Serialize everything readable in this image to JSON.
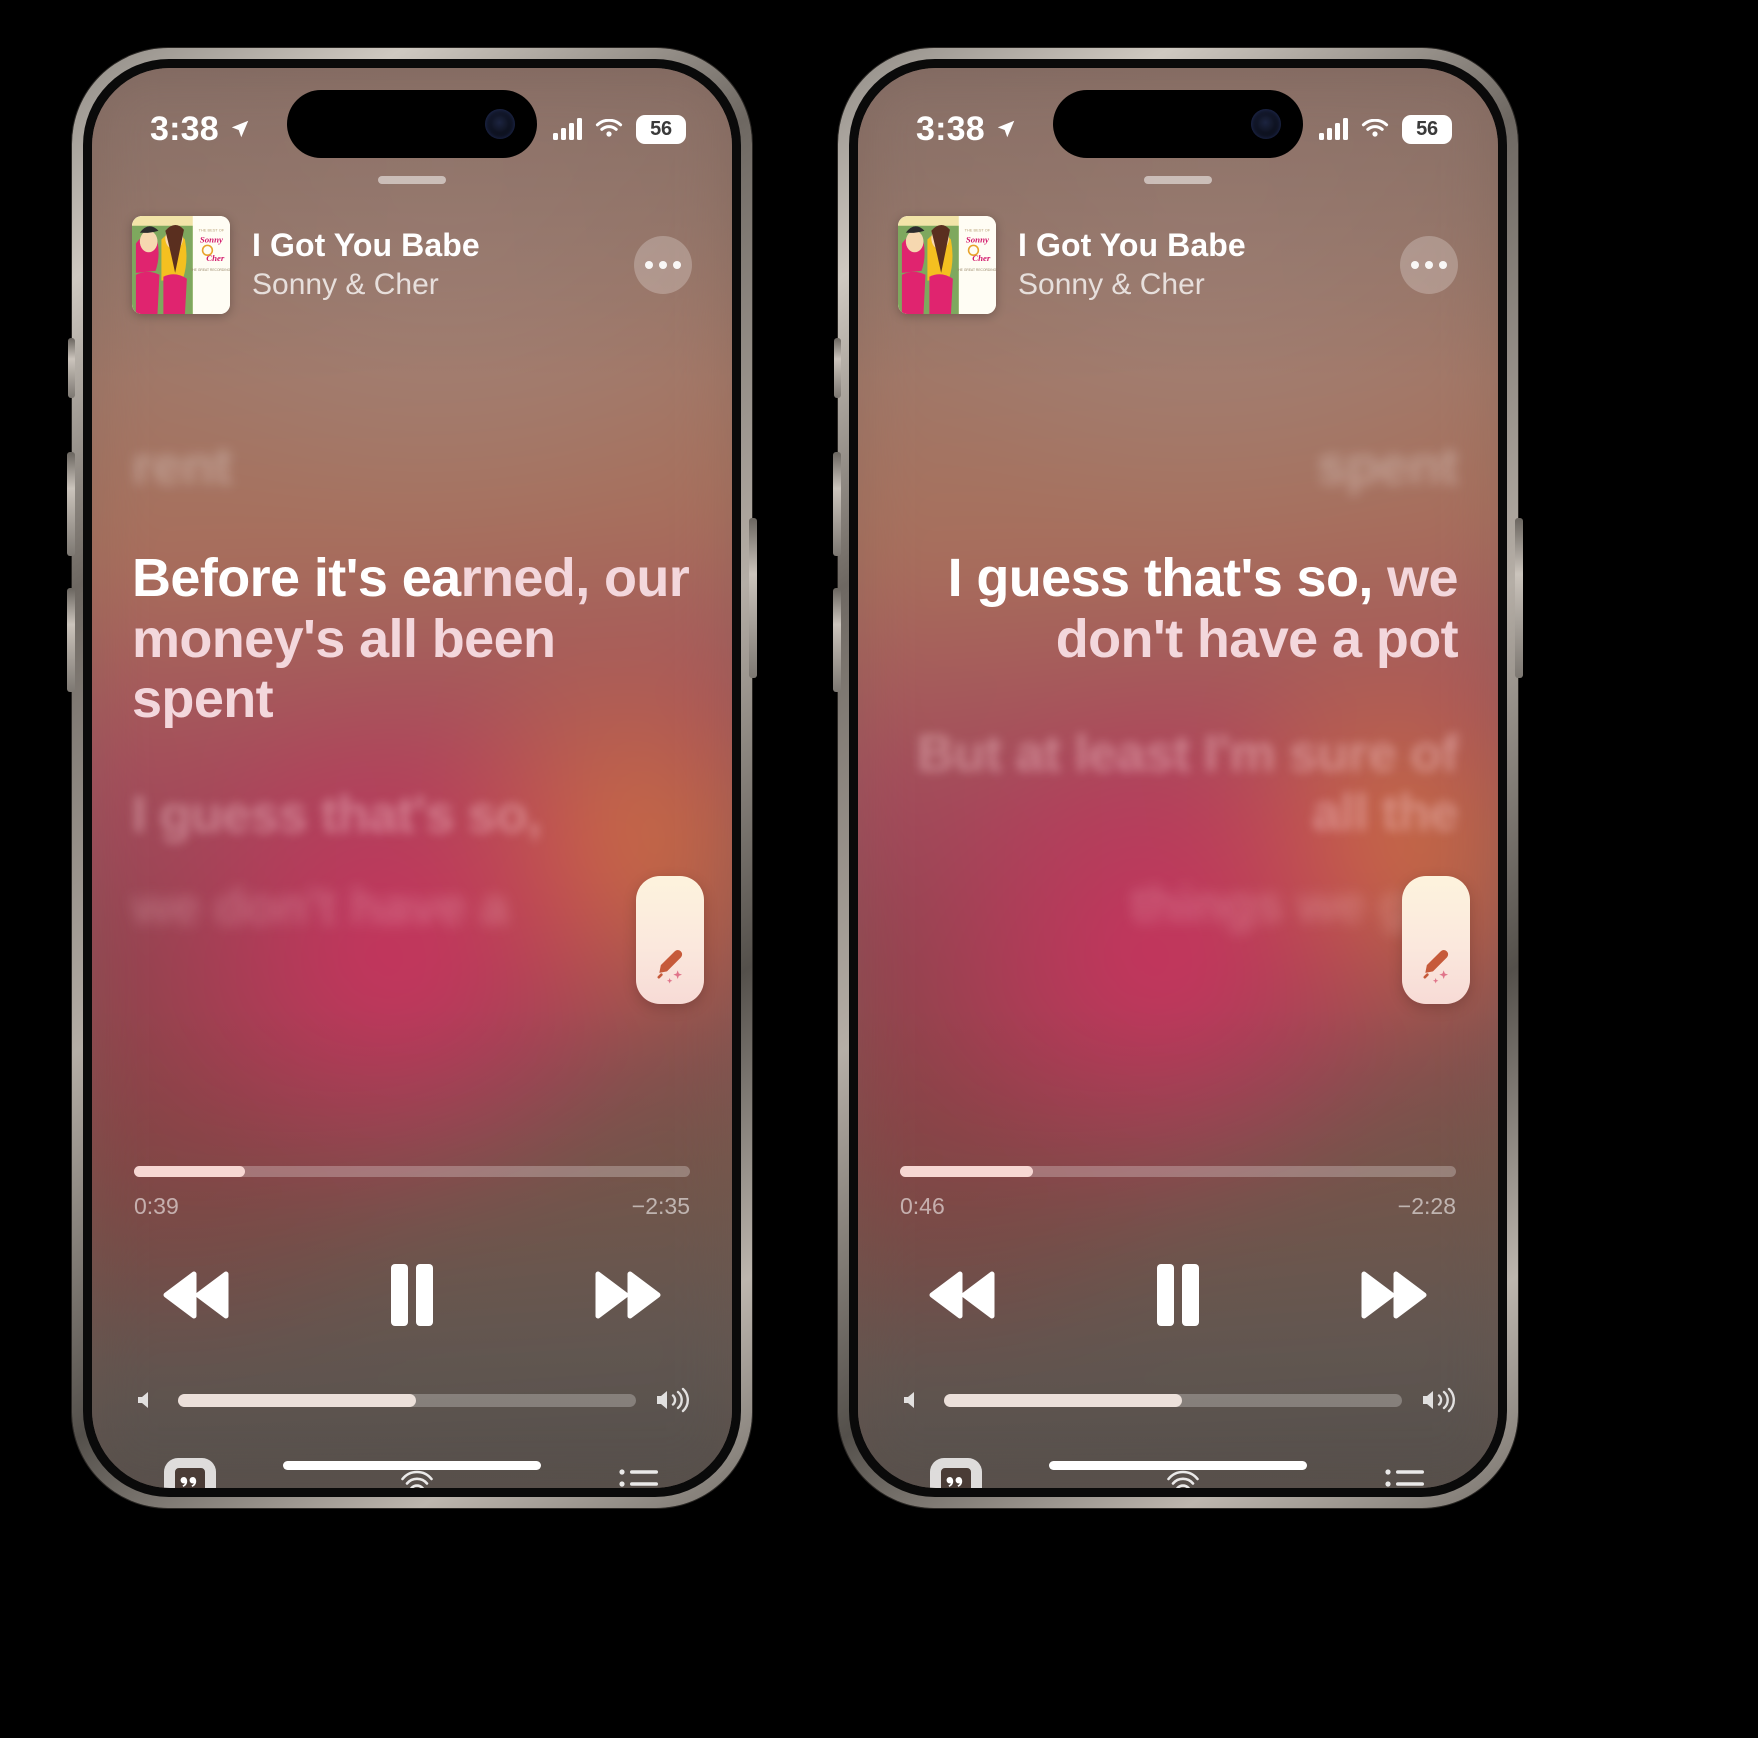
{
  "screens": [
    {
      "id": "left",
      "status": {
        "time": "3:38",
        "location_icon": "location-arrow-icon",
        "cellular_icon": "cellular-bars-icon",
        "wifi_icon": "wifi-icon",
        "battery": "56"
      },
      "now_playing": {
        "title": "I Got You Babe",
        "artist": "Sonny & Cher",
        "artwork_alt": "Sonny & Cher — The Best Of",
        "more_button": "More options"
      },
      "lyrics": {
        "alignment": "left",
        "previous": "rent",
        "active": {
          "sung": "Before it's ea",
          "unsung": "rned, our money's all been spent",
          "full": "Before it's earned, our money's all been spent"
        },
        "upcoming": [
          "I guess that's so,",
          "we don't have a"
        ]
      },
      "sing_button": {
        "icon": "microphone-sparkle-icon",
        "label": "Sing"
      },
      "progress": {
        "elapsed": "0:39",
        "remaining": "−2:35",
        "percent": 20
      },
      "transport": {
        "rewind": "Rewind",
        "play_pause": "Pause",
        "forward": "Fast forward",
        "state": "playing"
      },
      "volume": {
        "percent": 52,
        "min_icon": "speaker-min-icon",
        "max_icon": "speaker-max-icon"
      },
      "tabs": [
        {
          "name": "lyrics",
          "icon": "lyrics-quote-icon",
          "active": true
        },
        {
          "name": "airplay",
          "icon": "airplay-audio-icon",
          "active": false
        },
        {
          "name": "queue",
          "icon": "queue-list-icon",
          "active": false
        }
      ]
    },
    {
      "id": "right",
      "status": {
        "time": "3:38",
        "location_icon": "location-arrow-icon",
        "cellular_icon": "cellular-bars-icon",
        "wifi_icon": "wifi-icon",
        "battery": "56"
      },
      "now_playing": {
        "title": "I Got You Babe",
        "artist": "Sonny & Cher",
        "artwork_alt": "Sonny & Cher — The Best Of",
        "more_button": "More options"
      },
      "lyrics": {
        "alignment": "right",
        "previous": "spent",
        "active": {
          "sung": "I guess that's so,",
          "unsung": "we don't have a pot",
          "full": "I guess that's so, we don't have a pot"
        },
        "upcoming": [
          "But at least I'm sure of all the",
          "things we got"
        ]
      },
      "sing_button": {
        "icon": "microphone-sparkle-icon",
        "label": "Sing"
      },
      "progress": {
        "elapsed": "0:46",
        "remaining": "−2:28",
        "percent": 24
      },
      "transport": {
        "rewind": "Rewind",
        "play_pause": "Pause",
        "forward": "Fast forward",
        "state": "playing"
      },
      "volume": {
        "percent": 52,
        "min_icon": "speaker-min-icon",
        "max_icon": "speaker-max-icon"
      },
      "tabs": [
        {
          "name": "lyrics",
          "icon": "lyrics-quote-icon",
          "active": true
        },
        {
          "name": "airplay",
          "icon": "airplay-audio-icon",
          "active": false
        },
        {
          "name": "queue",
          "icon": "queue-list-icon",
          "active": false
        }
      ]
    }
  ],
  "colors": {
    "sung_lyric": "#ffffff",
    "unsung_lyric": "#f3d7dc",
    "accent_pill": "#fdf3dd",
    "progress_fill": "#f7d7d3"
  }
}
